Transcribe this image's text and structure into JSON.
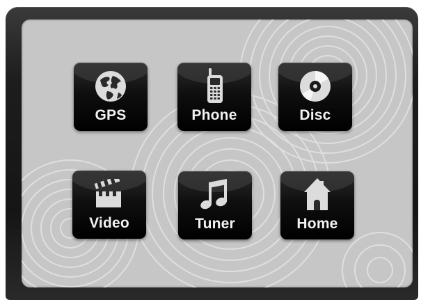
{
  "menu": {
    "tiles": [
      {
        "label": "GPS",
        "icon": "globe-icon"
      },
      {
        "label": "Phone",
        "icon": "mobile-phone-icon"
      },
      {
        "label": "Disc",
        "icon": "disc-icon"
      },
      {
        "label": "Video",
        "icon": "clapperboard-icon"
      },
      {
        "label": "Tuner",
        "icon": "music-note-icon"
      },
      {
        "label": "Home",
        "icon": "house-icon"
      }
    ]
  },
  "colors": {
    "bezel": "#1d1d1d",
    "screen": "#c6c6c6",
    "tile": "#0f0f0f",
    "tile_text": "#f2f2f2",
    "icon": "#dcdcdc"
  }
}
